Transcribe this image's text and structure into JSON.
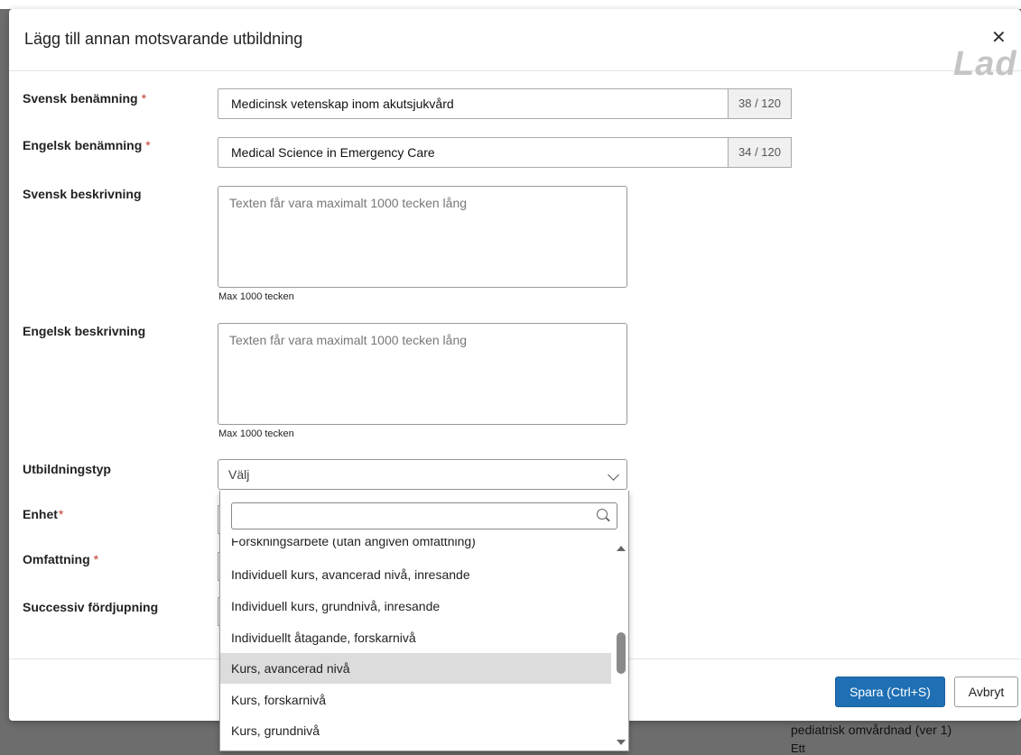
{
  "dialog": {
    "title": "Lägg till annan motsvarande utbildning",
    "watermark": "Lad"
  },
  "fields": {
    "svensk_benamning": {
      "label": "Svensk benämning",
      "required": "*",
      "value": "Medicinsk vetenskap inom akutsjukvård",
      "counter": "38 / 120"
    },
    "engelsk_benamning": {
      "label": "Engelsk benämning",
      "required": "*",
      "value": "Medical Science in Emergency Care",
      "counter": "34 / 120"
    },
    "svensk_beskrivning": {
      "label": "Svensk beskrivning",
      "placeholder": "Texten får vara maximalt 1000 tecken lång",
      "hint": "Max 1000 tecken"
    },
    "engelsk_beskrivning": {
      "label": "Engelsk beskrivning",
      "placeholder": "Texten får vara maximalt 1000 tecken lång",
      "hint": "Max 1000 tecken"
    },
    "utbildningstyp": {
      "label": "Utbildningstyp",
      "value": "Välj"
    },
    "enhet": {
      "label": "Enhet",
      "required": "*"
    },
    "omfattning": {
      "label": "Omfattning",
      "required": "*"
    },
    "successiv": {
      "label": "Successiv fördjupning"
    }
  },
  "dropdown": {
    "search_value": "",
    "items": [
      "Forskningsarbete (utan angiven omfattning)",
      "Individuell kurs, avancerad nivå, inresande",
      "Individuell kurs, grundnivå, inresande",
      "Individuellt åtagande, forskarnivå",
      "Kurs, avancerad nivå",
      "Kurs, forskarnivå",
      "Kurs, grundnivå"
    ],
    "highlighted_index": 4
  },
  "footer": {
    "save_label": "Spara (Ctrl+S)",
    "cancel_label": "Avbryt"
  },
  "background": {
    "text1": "pediatrisk omvårdnad (ver 1)",
    "text2": "Ett"
  },
  "colors": {
    "primary": "#1f6fb5",
    "required": "#c0392b",
    "highlight": "#dcdcdc"
  }
}
